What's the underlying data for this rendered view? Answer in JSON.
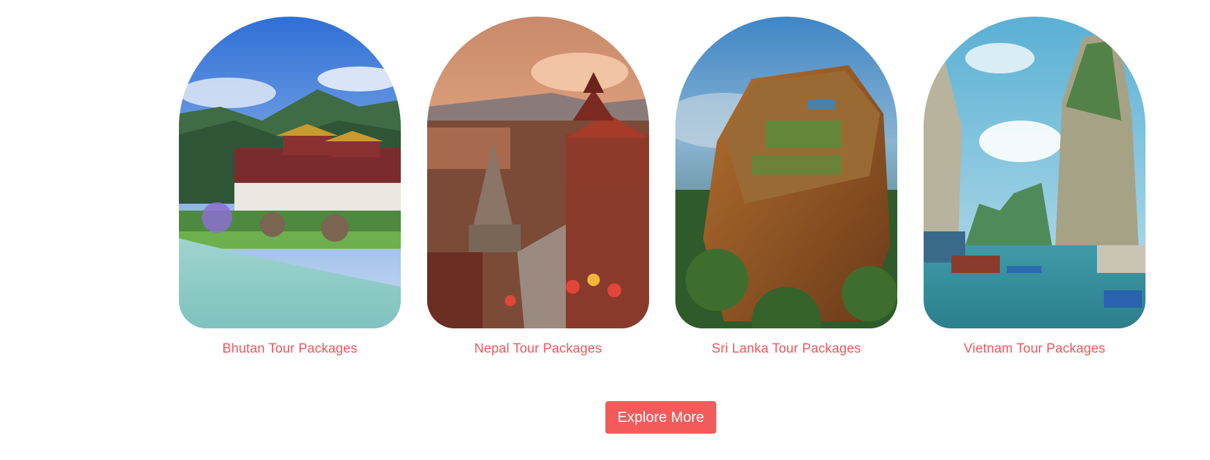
{
  "destinations": [
    {
      "label": "Bhutan Tour Packages",
      "image": "bhutan-dzong-river-photo"
    },
    {
      "label": "Nepal Tour Packages",
      "image": "nepal-temple-square-photo"
    },
    {
      "label": "Sri Lanka Tour Packages",
      "image": "sigiriya-rock-photo"
    },
    {
      "label": "Vietnam Tour Packages",
      "image": "halong-bay-photo"
    }
  ],
  "cta": {
    "label": "Explore More"
  },
  "colors": {
    "accent": "#f35b5b",
    "label_text": "#f2555a",
    "button_text": "#ffffff",
    "background": "#ffffff"
  }
}
